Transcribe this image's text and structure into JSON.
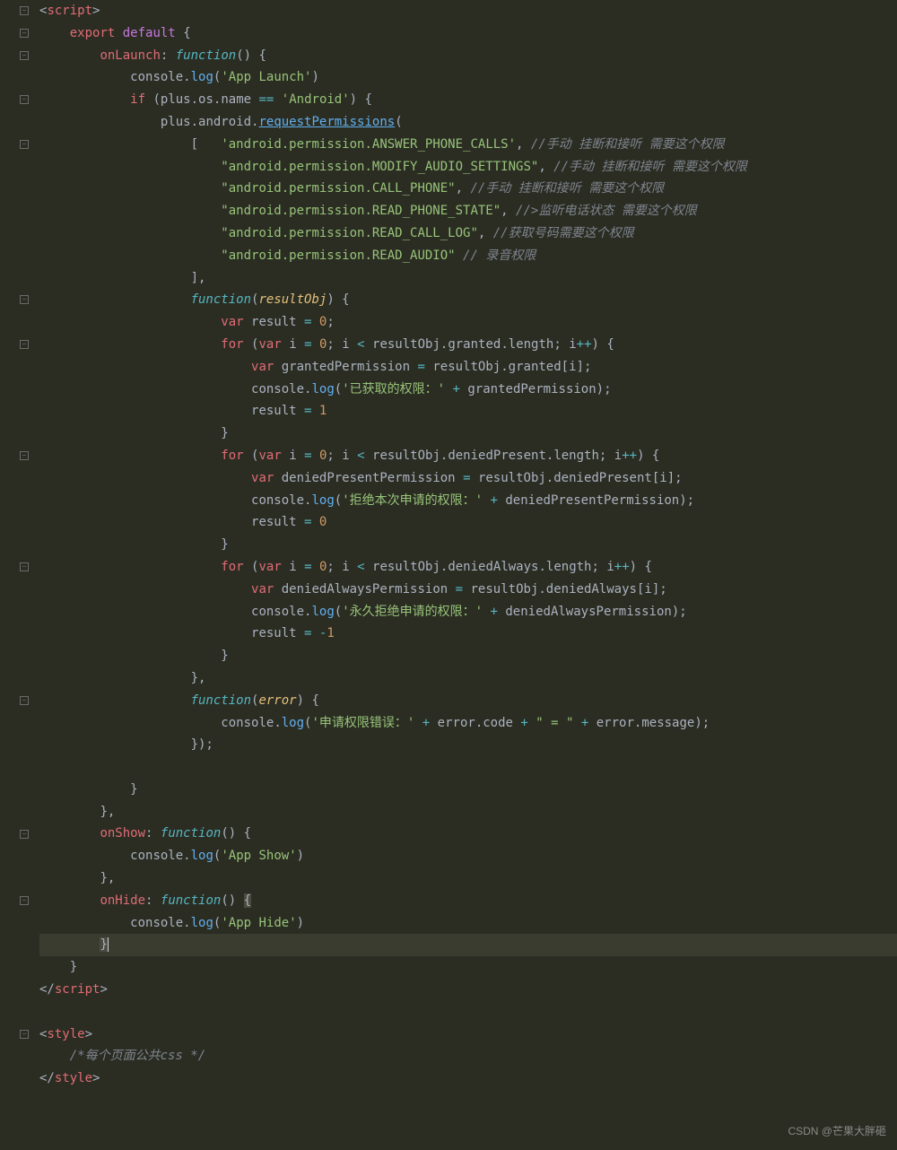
{
  "code": {
    "lines": [
      {
        "html": "<span class='punct'>&lt;</span><span class='tag'>script</span><span class='punct'>&gt;</span>"
      },
      {
        "html": "    <span class='kw1'>export</span> <span class='kw2'>default</span> <span class='punct'>{</span>"
      },
      {
        "html": "        <span class='prop'>onLaunch</span><span class='punct'>:</span> <span class='fn-italic'>function</span><span class='punct'>() {</span>"
      },
      {
        "html": "            <span class='ident'>console</span><span class='punct'>.</span><span class='fn'>log</span><span class='punct'>(</span><span class='str'>'App Launch'</span><span class='punct'>)</span>"
      },
      {
        "html": "            <span class='kw1'>if</span> <span class='punct'>(</span><span class='ident'>plus</span><span class='punct'>.</span><span class='ident'>os</span><span class='punct'>.</span><span class='ident'>name</span> <span class='op'>==</span> <span class='str'>'Android'</span><span class='punct'>) {</span>"
      },
      {
        "html": "                <span class='ident'>plus</span><span class='punct'>.</span><span class='ident'>android</span><span class='punct'>.</span><span class='fn underline'>requestPermissions</span><span class='punct'>(</span>"
      },
      {
        "html": "                    <span class='punct'>[</span>   <span class='str'>'android.permission.ANSWER_PHONE_CALLS'</span><span class='punct'>,</span> <span class='comment'>//手动 挂断和接听 需要这个权限</span>"
      },
      {
        "html": "                        <span class='str'>\"android.permission.MODIFY_AUDIO_SETTINGS\"</span><span class='punct'>,</span> <span class='comment'>//手动 挂断和接听 需要这个权限</span>"
      },
      {
        "html": "                        <span class='str'>\"android.permission.CALL_PHONE\"</span><span class='punct'>,</span> <span class='comment'>//手动 挂断和接听 需要这个权限</span>"
      },
      {
        "html": "                        <span class='str'>\"android.permission.READ_PHONE_STATE\"</span><span class='punct'>,</span> <span class='comment'>//&gt;监听电话状态 需要这个权限</span>"
      },
      {
        "html": "                        <span class='str'>\"android.permission.READ_CALL_LOG\"</span><span class='punct'>,</span> <span class='comment'>//获取号码需要这个权限</span>"
      },
      {
        "html": "                        <span class='str'>\"android.permission.READ_AUDIO\"</span> <span class='comment'>// 录音权限</span>"
      },
      {
        "html": "                    <span class='punct'>],</span>"
      },
      {
        "html": "                    <span class='fn-italic'>function</span><span class='punct'>(</span><span class='param'>resultObj</span><span class='punct'>) {</span>"
      },
      {
        "html": "                        <span class='kw1'>var</span> <span class='ident'>result</span> <span class='op'>=</span> <span class='num'>0</span><span class='punct'>;</span>"
      },
      {
        "html": "                        <span class='kw1'>for</span> <span class='punct'>(</span><span class='kw1'>var</span> <span class='ident'>i</span> <span class='op'>=</span> <span class='num'>0</span><span class='punct'>;</span> <span class='ident'>i</span> <span class='op'>&lt;</span> <span class='ident'>resultObj</span><span class='punct'>.</span><span class='ident'>granted</span><span class='punct'>.</span><span class='ident'>length</span><span class='punct'>;</span> <span class='ident'>i</span><span class='op'>++</span><span class='punct'>) {</span>"
      },
      {
        "html": "                            <span class='kw1'>var</span> <span class='ident'>grantedPermission</span> <span class='op'>=</span> <span class='ident'>resultObj</span><span class='punct'>.</span><span class='ident'>granted</span><span class='punct'>[</span><span class='ident'>i</span><span class='punct'>];</span>"
      },
      {
        "html": "                            <span class='ident'>console</span><span class='punct'>.</span><span class='fn'>log</span><span class='punct'>(</span><span class='str'>'已获取的权限：'</span> <span class='op'>+</span> <span class='ident'>grantedPermission</span><span class='punct'>);</span>"
      },
      {
        "html": "                            <span class='ident'>result</span> <span class='op'>=</span> <span class='num'>1</span>"
      },
      {
        "html": "                        <span class='punct'>}</span>"
      },
      {
        "html": "                        <span class='kw1'>for</span> <span class='punct'>(</span><span class='kw1'>var</span> <span class='ident'>i</span> <span class='op'>=</span> <span class='num'>0</span><span class='punct'>;</span> <span class='ident'>i</span> <span class='op'>&lt;</span> <span class='ident'>resultObj</span><span class='punct'>.</span><span class='ident'>deniedPresent</span><span class='punct'>.</span><span class='ident'>length</span><span class='punct'>;</span> <span class='ident'>i</span><span class='op'>++</span><span class='punct'>) {</span>"
      },
      {
        "html": "                            <span class='kw1'>var</span> <span class='ident'>deniedPresentPermission</span> <span class='op'>=</span> <span class='ident'>resultObj</span><span class='punct'>.</span><span class='ident'>deniedPresent</span><span class='punct'>[</span><span class='ident'>i</span><span class='punct'>];</span>"
      },
      {
        "html": "                            <span class='ident'>console</span><span class='punct'>.</span><span class='fn'>log</span><span class='punct'>(</span><span class='str'>'拒绝本次申请的权限：'</span> <span class='op'>+</span> <span class='ident'>deniedPresentPermission</span><span class='punct'>);</span>"
      },
      {
        "html": "                            <span class='ident'>result</span> <span class='op'>=</span> <span class='num'>0</span>"
      },
      {
        "html": "                        <span class='punct'>}</span>"
      },
      {
        "html": "                        <span class='kw1'>for</span> <span class='punct'>(</span><span class='kw1'>var</span> <span class='ident'>i</span> <span class='op'>=</span> <span class='num'>0</span><span class='punct'>;</span> <span class='ident'>i</span> <span class='op'>&lt;</span> <span class='ident'>resultObj</span><span class='punct'>.</span><span class='ident'>deniedAlways</span><span class='punct'>.</span><span class='ident'>length</span><span class='punct'>;</span> <span class='ident'>i</span><span class='op'>++</span><span class='punct'>) {</span>"
      },
      {
        "html": "                            <span class='kw1'>var</span> <span class='ident'>deniedAlwaysPermission</span> <span class='op'>=</span> <span class='ident'>resultObj</span><span class='punct'>.</span><span class='ident'>deniedAlways</span><span class='punct'>[</span><span class='ident'>i</span><span class='punct'>];</span>"
      },
      {
        "html": "                            <span class='ident'>console</span><span class='punct'>.</span><span class='fn'>log</span><span class='punct'>(</span><span class='str'>'永久拒绝申请的权限：'</span> <span class='op'>+</span> <span class='ident'>deniedAlwaysPermission</span><span class='punct'>);</span>"
      },
      {
        "html": "                            <span class='ident'>result</span> <span class='op'>=</span> <span class='op'>-</span><span class='num'>1</span>"
      },
      {
        "html": "                        <span class='punct'>}</span>"
      },
      {
        "html": "                    <span class='punct'>},</span>"
      },
      {
        "html": "                    <span class='fn-italic'>function</span><span class='punct'>(</span><span class='param'>error</span><span class='punct'>) {</span>"
      },
      {
        "html": "                        <span class='ident'>console</span><span class='punct'>.</span><span class='fn'>log</span><span class='punct'>(</span><span class='str'>'申请权限错误：'</span> <span class='op'>+</span> <span class='ident'>error</span><span class='punct'>.</span><span class='ident'>code</span> <span class='op'>+</span> <span class='str'>\" = \"</span> <span class='op'>+</span> <span class='ident'>error</span><span class='punct'>.</span><span class='ident'>message</span><span class='punct'>);</span>"
      },
      {
        "html": "                    <span class='punct'>});</span>"
      },
      {
        "html": ""
      },
      {
        "html": "            <span class='punct'>}</span>"
      },
      {
        "html": "        <span class='punct'>},</span>"
      },
      {
        "html": "        <span class='prop'>onShow</span><span class='punct'>:</span> <span class='fn-italic'>function</span><span class='punct'>() {</span>"
      },
      {
        "html": "            <span class='ident'>console</span><span class='punct'>.</span><span class='fn'>log</span><span class='punct'>(</span><span class='str'>'App Show'</span><span class='punct'>)</span>"
      },
      {
        "html": "        <span class='punct'>},</span>"
      },
      {
        "html": "        <span class='prop'>onHide</span><span class='punct'>:</span> <span class='fn-italic'>function</span><span class='punct'>()</span> <span class='punct' style='background:#4a4c40'>{</span>"
      },
      {
        "html": "            <span class='ident'>console</span><span class='punct'>.</span><span class='fn'>log</span><span class='punct'>(</span><span class='str'>'App Hide'</span><span class='punct'>)</span>"
      },
      {
        "html": "        <span class='punct' style='background:#4a4c40'>}</span><span class='cursor-mark'></span>",
        "highlight": true
      },
      {
        "html": "    <span class='punct'>}</span>"
      },
      {
        "html": "<span class='punct'>&lt;/</span><span class='tag'>script</span><span class='punct'>&gt;</span>"
      },
      {
        "html": ""
      },
      {
        "html": "<span class='punct'>&lt;</span><span class='tag'>style</span><span class='punct'>&gt;</span>"
      },
      {
        "html": "    <span class='comment'>/*每个页面公共css */</span>"
      },
      {
        "html": "<span class='punct'>&lt;/</span><span class='tag'>style</span><span class='punct'>&gt;</span>"
      }
    ]
  },
  "foldMarks": [
    0,
    1,
    2,
    4,
    6,
    13,
    15,
    20,
    25,
    31,
    37,
    40,
    46
  ],
  "watermark": "CSDN @芒果大胖砸",
  "watermark2": ""
}
